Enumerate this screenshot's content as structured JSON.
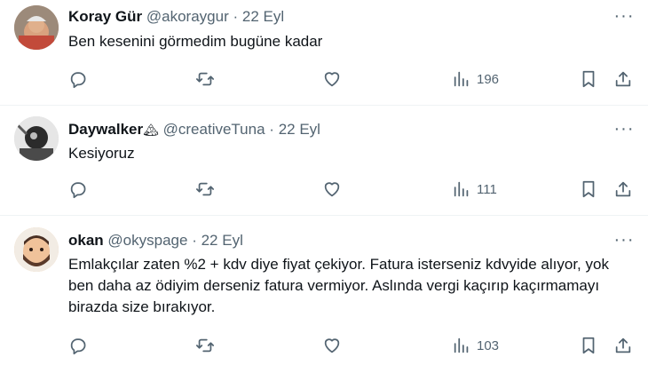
{
  "tweets": [
    {
      "name": "Koray Gür",
      "badge": "",
      "handle": "@akoraygur",
      "dot": "·",
      "date": "22 Eyl",
      "text": "Ben kesenini görmedim bugüne kadar",
      "views": "196",
      "avatar_colors": [
        "#c9a38a",
        "#7a4d3a"
      ]
    },
    {
      "name": "Daywalker",
      "badge": "🏔",
      "handle": "@creativeTuna",
      "dot": "·",
      "date": "22 Eyl",
      "text": "Kesiyoruz",
      "views": "111",
      "avatar_colors": [
        "#d8d8d8",
        "#3a3a3a"
      ]
    },
    {
      "name": "okan",
      "badge": "",
      "handle": "@okyspage",
      "dot": "·",
      "date": "22 Eyl",
      "text": "Emlakçılar zaten %2 + kdv diye fiyat çekiyor. Fatura isterseniz kdvyide alıyor, yok ben daha az ödiyim derseniz fatura vermiyor. Aslında vergi kaçırıp kaçırmamayı birazda size bırakıyor.",
      "views": "103",
      "avatar_colors": [
        "#f0c9a0",
        "#5a3a2a"
      ]
    }
  ],
  "more_glyph": "···",
  "icons": [
    "reply-icon",
    "retweet-icon",
    "like-icon",
    "views-icon",
    "bookmark-icon",
    "share-icon"
  ],
  "colors": {
    "text": "#0f1419",
    "secondary": "#536471",
    "divider": "#eff3f4"
  }
}
